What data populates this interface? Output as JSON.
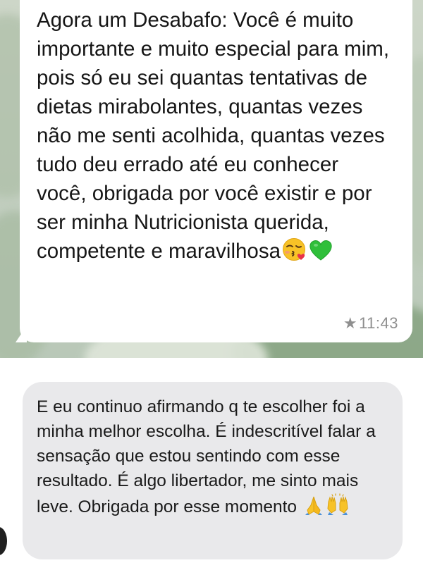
{
  "whatsapp": {
    "message": "Agora um Desabafo: Você é muito importante e muito especial para mim, pois só eu sei quantas tentativas de dietas mirabolantes, quantas vezes não me senti acolhida, quantas vezes tudo deu errado até eu conhecer você, obrigada por você existir e por ser minha Nutricionista querida, competente e maravilhosa",
    "emojis": [
      "kissing-face-with-heart-icon",
      "green-heart-icon"
    ],
    "starred": true,
    "time": "11:43"
  },
  "imessage": {
    "message": "E eu continuo afirmando q te escolher foi a minha melhor escolha. É indescritível falar a sensação que estou sentindo com esse resultado. É algo libertador, me sinto mais leve. Obrigada por esse momento",
    "emojis": [
      "folded-hands-icon",
      "raising-hands-icon"
    ]
  },
  "colors": {
    "whatsapp_bubble": "#ffffff",
    "imessage_bubble": "#e9e9eb",
    "wallpaper": "#c3cfc0",
    "timestamp": "#8f8f8f"
  }
}
